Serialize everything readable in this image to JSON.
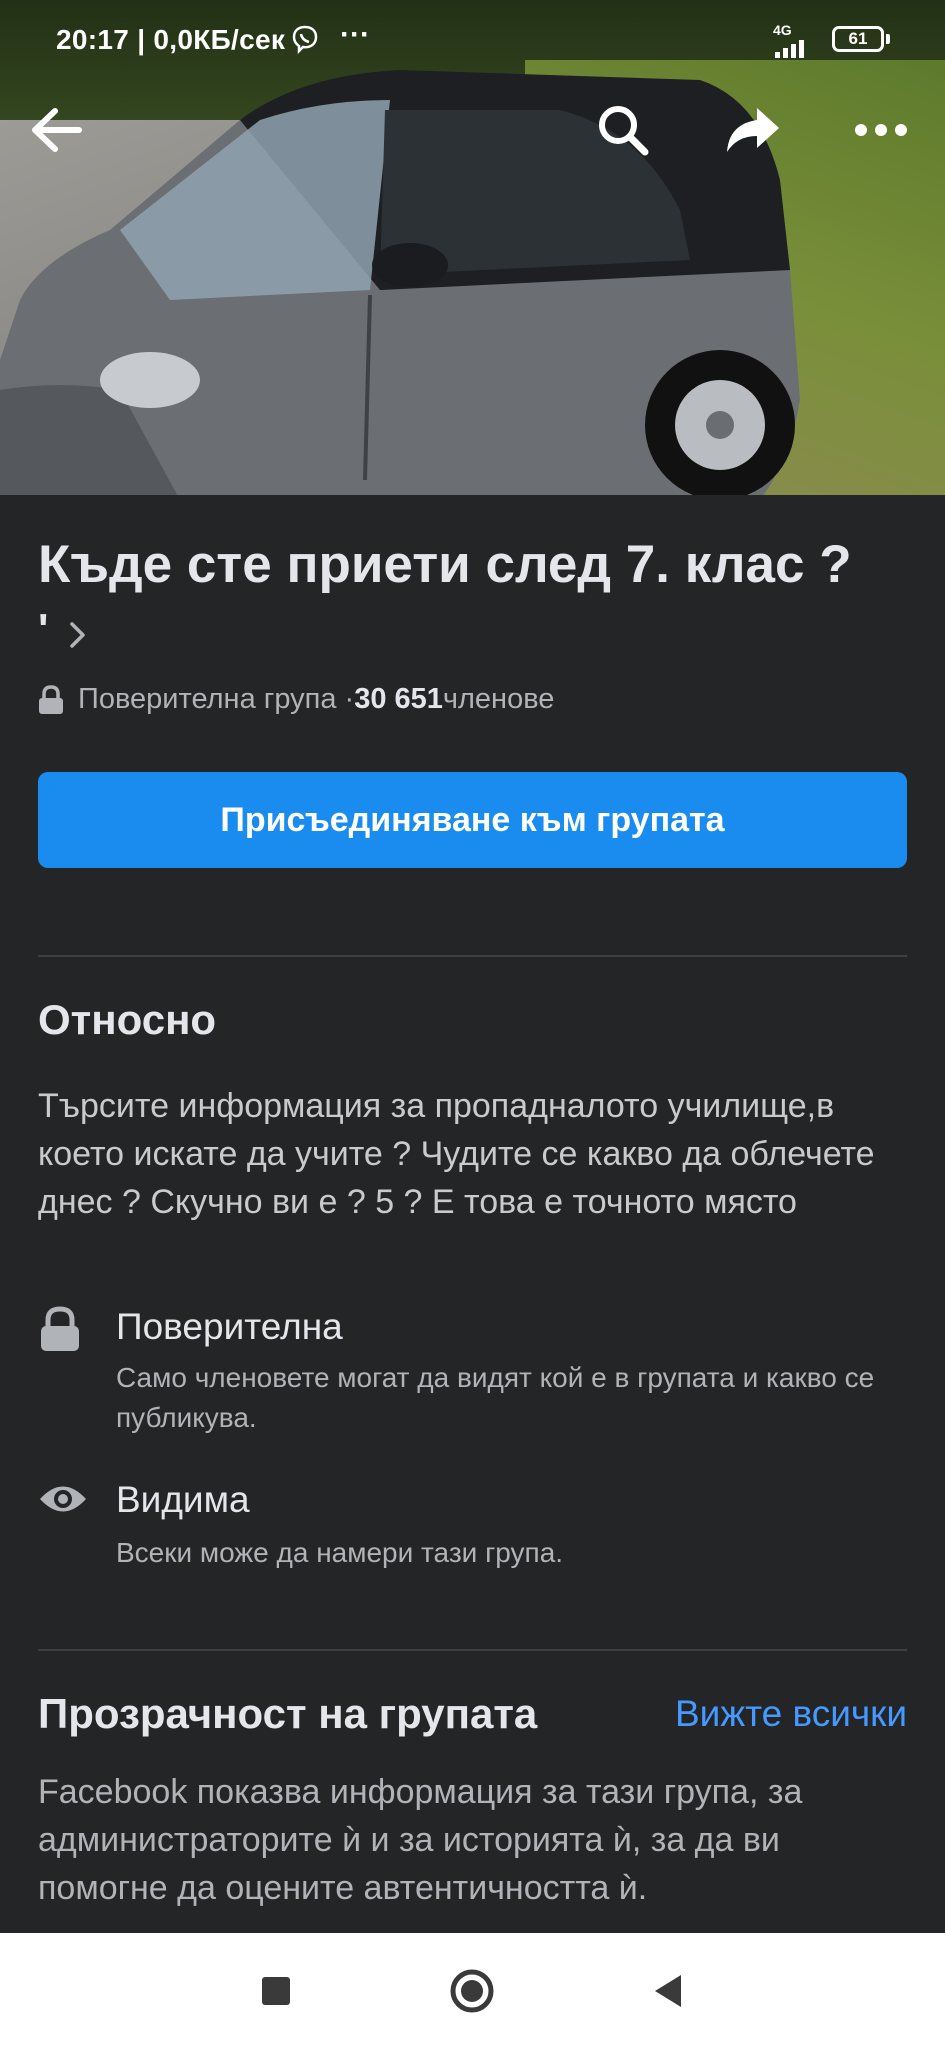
{
  "status_bar": {
    "time_speed": "20:17 | 0,0КБ/сек",
    "dots": "···",
    "network": "4G",
    "battery": "61"
  },
  "group": {
    "title": "Къде сте приети след 7. клас ?",
    "title_tail": "'",
    "privacy_label": "Поверителна група · ",
    "member_count": "30 651",
    "members_word": " членове",
    "join_button": "Присъединяване към групата"
  },
  "about": {
    "heading": "Относно",
    "description": "Търсите информация за пропадналото училище,в което искате да учите ? Чудите се какво да облечете днес ? Скучно ви е ? 5 ? Е това е точното място",
    "items": [
      {
        "icon": "lock-icon",
        "title": "Поверителна",
        "subtitle": "Само членовете могат да видят кой е в групата и какво се публикува."
      },
      {
        "icon": "eye-icon",
        "title": "Видима",
        "subtitle": "Всеки може да намери тази група."
      }
    ]
  },
  "transparency": {
    "heading": "Прозрачност на групата",
    "see_all": "Вижте всички",
    "description": "Facebook показва информация за тази група, за администраторите ѝ и за историята ѝ, за да ви помогне да оцените автентичността ѝ."
  },
  "colors": {
    "background": "#242526",
    "accent_button": "#1a8cf0",
    "link": "#4599ff"
  }
}
